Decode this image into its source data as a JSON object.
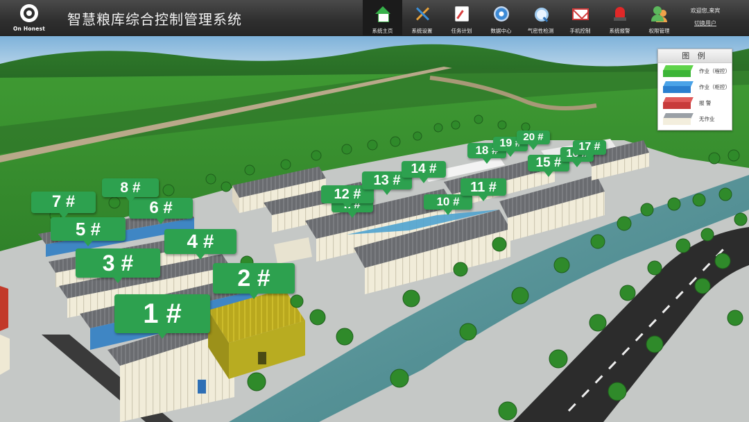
{
  "brand": {
    "logo_text": "On Honest"
  },
  "app_title": "智慧粮库综合控制管理系统",
  "nav": [
    {
      "label": "系统主页",
      "icon": "home-icon",
      "active": true
    },
    {
      "label": "系统设置",
      "icon": "tools-icon",
      "active": false
    },
    {
      "label": "任务计划",
      "icon": "task-icon",
      "active": false
    },
    {
      "label": "数据中心",
      "icon": "data-center-icon",
      "active": false
    },
    {
      "label": "气密性检测",
      "icon": "gas-detect-icon",
      "active": false
    },
    {
      "label": "手机控制",
      "icon": "mail-icon",
      "active": false
    },
    {
      "label": "系统报警",
      "icon": "alarm-icon",
      "active": false
    },
    {
      "label": "权限管理",
      "icon": "users-icon",
      "active": false
    }
  ],
  "user": {
    "welcome": "欢迎您,来宾",
    "switch_label": "切换用户"
  },
  "legend": {
    "title": "图 例",
    "items": [
      {
        "label": "作业（程控）",
        "roof": "#5fd34a",
        "wall": "#3cb537"
      },
      {
        "label": "作业（柜控）",
        "roof": "#4aa3e8",
        "wall": "#2a7fcf"
      },
      {
        "label": "报 警",
        "roof": "#e05a5a",
        "wall": "#c83b3b"
      },
      {
        "label": "无作业",
        "roof": "#9aa0a6",
        "wall": "#f3eedd"
      }
    ]
  },
  "warehouses": [
    {
      "label": "1 #"
    },
    {
      "label": "2 #"
    },
    {
      "label": "3 #"
    },
    {
      "label": "4 #"
    },
    {
      "label": "5 #"
    },
    {
      "label": "6 #"
    },
    {
      "label": "7 #"
    },
    {
      "label": "8 #"
    },
    {
      "label": "10 #"
    },
    {
      "label": "11 #"
    },
    {
      "label": "12 #"
    },
    {
      "label": "13 #"
    },
    {
      "label": "14 #"
    },
    {
      "label": "15 #"
    },
    {
      "label": "16 #"
    },
    {
      "label": "17 #"
    },
    {
      "label": "18 #"
    },
    {
      "label": "19 #"
    },
    {
      "label": "20 #"
    },
    {
      "label": "2 #"
    }
  ]
}
